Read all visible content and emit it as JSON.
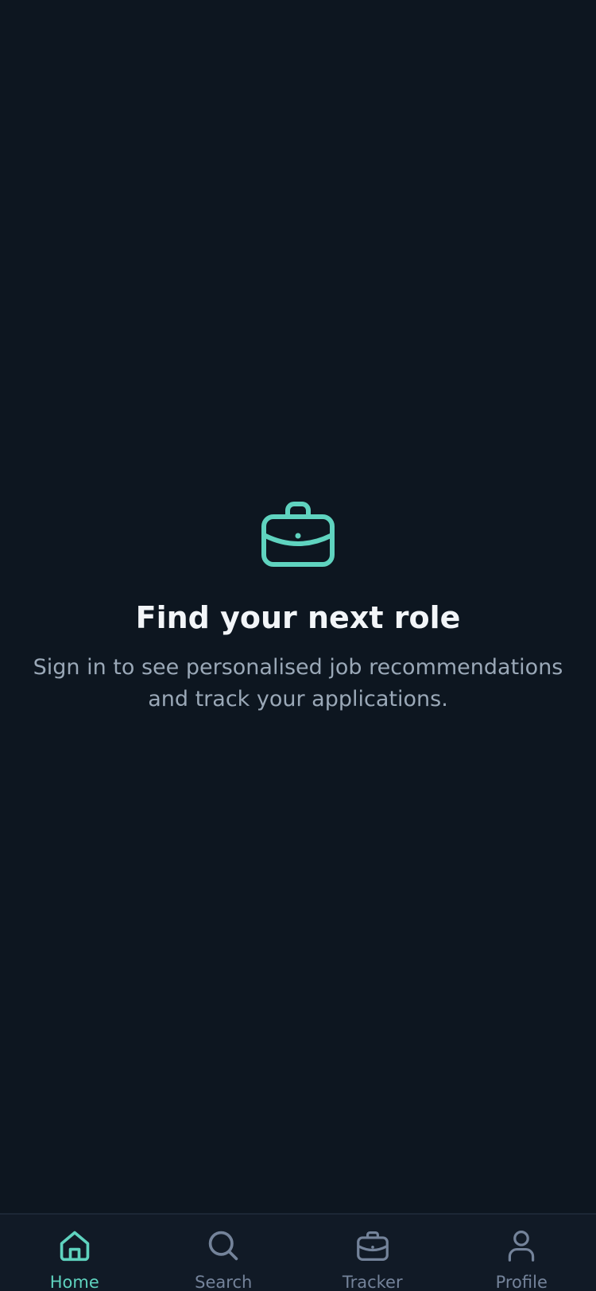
{
  "colors": {
    "background": "#0d1620",
    "tab_bar": "#111a26",
    "accent": "#5fd3bf",
    "title": "#f2f5f8",
    "subtitle": "#9aa8b7",
    "inactive": "#74839a"
  },
  "empty_state": {
    "icon": "briefcase-icon",
    "title": "Find your next role",
    "subtitle": "Sign in to see personalised job recommendations and track your applications."
  },
  "tab_bar": {
    "active": "home",
    "tabs": [
      {
        "id": "home",
        "label": "Home",
        "icon": "home-icon"
      },
      {
        "id": "search",
        "label": "Search",
        "icon": "search-icon"
      },
      {
        "id": "tracker",
        "label": "Tracker",
        "icon": "briefcase-icon"
      },
      {
        "id": "profile",
        "label": "Profile",
        "icon": "person-icon"
      }
    ]
  }
}
